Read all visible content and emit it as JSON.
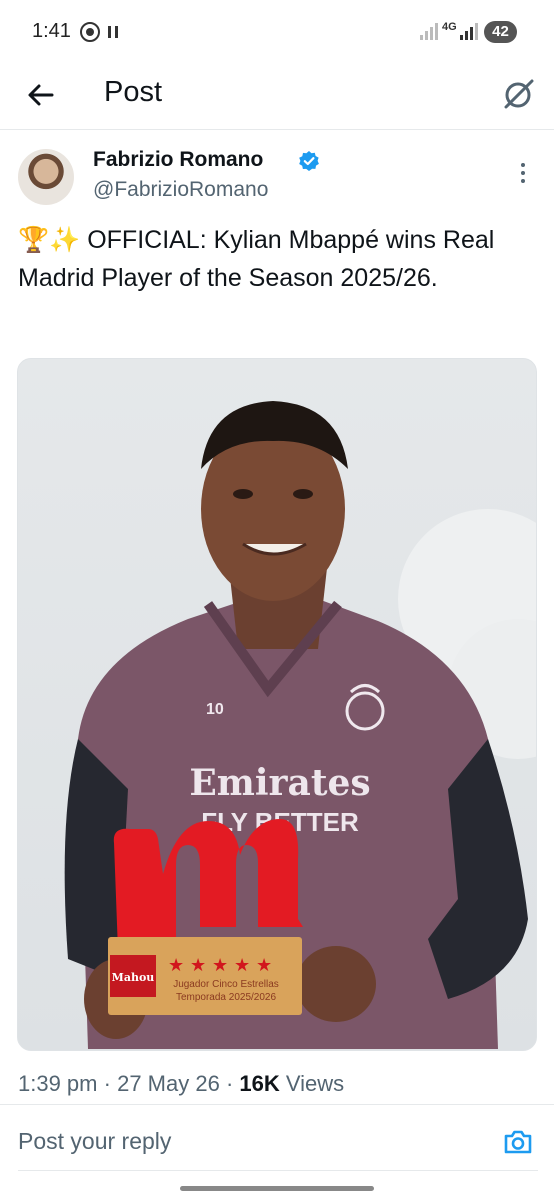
{
  "status_bar": {
    "time": "1:41",
    "network": "4G",
    "battery": "42",
    "icons": [
      "whatsapp-icon",
      "pause-icon",
      "signal-icon",
      "battery-icon"
    ]
  },
  "header": {
    "title": "Post",
    "back_icon": "arrow-left-icon",
    "grok_icon": "grok-icon"
  },
  "post": {
    "author": {
      "name": "Fabrizio Romano",
      "handle": "@FabrizioRomano",
      "verified": true
    },
    "text": "🏆✨ OFFICIAL: Kylian Mbappé wins Real Madrid Player of the Season 2025/26.",
    "media": {
      "jersey_number": "10",
      "sponsor_line1": "Emirates",
      "sponsor_line2": "FLY BETTER",
      "trophy_brand": "Mahou",
      "trophy_line1": "Jugador Cinco Estrellas",
      "trophy_line2": "Temporada 2025/2026"
    },
    "meta": {
      "time": "1:39 pm",
      "date": "27 May 26",
      "views_count": "16K",
      "views_label": "Views"
    }
  },
  "reply": {
    "placeholder": "Post your reply",
    "camera_icon": "camera-icon"
  },
  "colors": {
    "text_primary": "#0f1419",
    "text_secondary": "#536471",
    "accent": "#1d9bf0",
    "trophy_red": "#e31b23"
  }
}
